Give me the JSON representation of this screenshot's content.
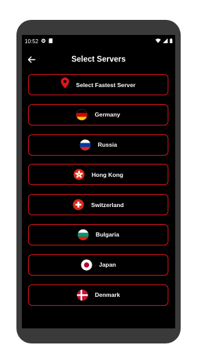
{
  "status_bar": {
    "time": "10:52"
  },
  "header": {
    "title": "Select Servers"
  },
  "fastest": {
    "label": "Select Fastest Server"
  },
  "servers": [
    {
      "label": "Germany",
      "flag": "germany-flag-icon"
    },
    {
      "label": "Russia",
      "flag": "russia-flag-icon"
    },
    {
      "label": "Hong Kong",
      "flag": "hong-kong-flag-icon"
    },
    {
      "label": "Switzerland",
      "flag": "switzerland-flag-icon"
    },
    {
      "label": "Bulgaria",
      "flag": "bulgaria-flag-icon"
    },
    {
      "label": "Japan",
      "flag": "japan-flag-icon"
    },
    {
      "label": "Denmark",
      "flag": "denmark-flag-icon"
    }
  ],
  "colors": {
    "accent": "#e0141c",
    "background": "#000000",
    "text": "#ffffff"
  }
}
